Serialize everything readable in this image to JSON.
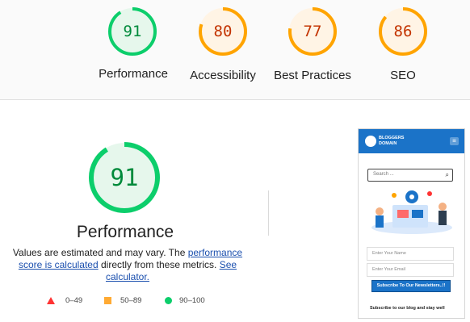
{
  "scores": [
    {
      "value": "91",
      "label": "Performance",
      "level": 0.91,
      "color": "#0cce6b",
      "text_color": "#008a3b",
      "bg": "#e6f7ec"
    },
    {
      "value": "80",
      "label": "Accessibility",
      "level": 0.8,
      "color": "#ffa400",
      "text_color": "#c33300",
      "bg": "#fff4e5"
    },
    {
      "value": "77",
      "label": "Best Practices",
      "level": 0.77,
      "color": "#ffa400",
      "text_color": "#c33300",
      "bg": "#fff4e5"
    },
    {
      "value": "86",
      "label": "SEO",
      "level": 0.86,
      "color": "#ffa400",
      "text_color": "#c33300",
      "bg": "#fff4e5"
    }
  ],
  "performance": {
    "value": "91",
    "title": "Performance",
    "level": 0.91,
    "desc_prefix": "Values are estimated and may vary. The ",
    "desc_link1": "performance score is calculated",
    "desc_middle": " directly from these metrics. ",
    "desc_link2": "See calculator."
  },
  "legend": {
    "fail": "0–49",
    "average": "50–89",
    "pass": "90–100",
    "fail_color": "#ff3333",
    "average_color": "#ffaa33",
    "pass_color": "#0cce6b"
  },
  "phone": {
    "brand_line1": "BLOGGERS",
    "brand_line2": "DOMAIN",
    "search_placeholder": "Search ...",
    "name_placeholder": "Enter Your Name",
    "email_placeholder": "Enter Your Email",
    "subscribe_label": "Subscribe To Our Newsletters..!!",
    "footer_text": "Subscribe to our blog and stay well"
  }
}
